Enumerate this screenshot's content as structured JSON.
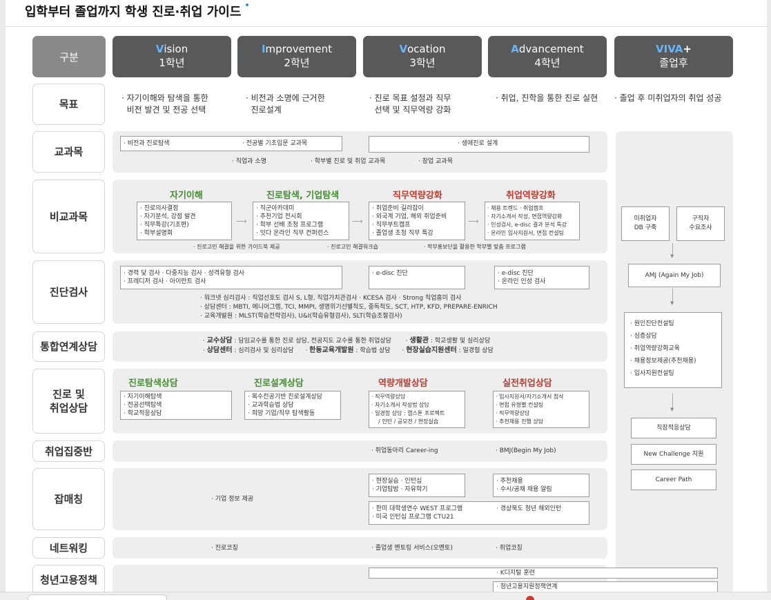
{
  "title": "입학부터 졸업까지 학생 진로·취업 가이드",
  "headers": [
    {
      "cap": "",
      "rest": "구분",
      "sub": ""
    },
    {
      "cap": "V",
      "rest": "ision",
      "sub": "1학년"
    },
    {
      "cap": "I",
      "rest": "mprovement",
      "sub": "2학년"
    },
    {
      "cap": "V",
      "rest": "ocation",
      "sub": "3학년"
    },
    {
      "cap": "A",
      "rest": "dvancement",
      "sub": "4학년"
    },
    {
      "cap": "VIVA",
      "rest": "+",
      "sub": "졸업후"
    }
  ],
  "rows": [
    "목표",
    "교과목",
    "비교과목",
    "진단검사",
    "통합연계상담",
    "진로 및\n취업상담",
    "취업집중반",
    "잡매칭",
    "네트워킹",
    "청년고용정책"
  ],
  "goals": [
    "· 자기이해와 탐색을 통한\n  비전 발견 및 전공 선택",
    "· 비전과 소명에 근거한\n  진로설계",
    "· 진로 목표 설정과 직무\n  선택 및 직무역량 강화",
    "· 취업, 진학을 통한 진로 실현",
    "· 졸업 후 미취업자의 취업 성공"
  ],
  "curriculum": {
    "box1a": "· 비전과 진로탐색",
    "box1b": "· 전공별 기초입문 교과목",
    "box2": "· 생애진로 설계",
    "line1": "· 직업과 소명",
    "line2": "· 학부별 진로 및 취업 교과목",
    "line3": "· 창업 교과목"
  },
  "extracurricular": {
    "cats": [
      "자기이해",
      "진로탐색, 기업탐색",
      "직무역량강화",
      "취업역량강화"
    ],
    "b1": [
      "· 진로의사결정",
      "· 자기분석, 강점 발견",
      "· 직무특강(기초편)",
      "· 학부설명회"
    ],
    "b2": [
      "· 직군아카데미",
      "· 추천기업 전시회",
      "· 학부 선배 초청 프로그램",
      "· 잇다 온라인 직무 컨퍼런스"
    ],
    "b3": [
      "· 취업준비 길라잡이",
      "· 외국계 기업, 해외 취업준비",
      "· 직무부트캠프",
      "· 졸업생 초청 직무 특강"
    ],
    "b4": [
      "· 채용 트렌드   · 취업캠프",
      "· 자기소개서 작성, 면접역량강화",
      "· 인성검사, e-disc 결과 분석 특강",
      "· 온라인 입사지원서, 면접 컨설팅"
    ],
    "notes": [
      "· 진로고민 해결을 위한 가이드북 제공",
      "· 진로고민 해결워크숍",
      "· 학부홍보단을 활용한 학부별 맞춤 프로그램"
    ]
  },
  "diagnostic": {
    "b1": [
      "· 경력 닻 검사      · 다중지능 검사  · 성격유형 검사",
      "· 프레디저 검사      · 아이란트 검사"
    ],
    "b2": "· e-disc 진단",
    "b3": [
      "· e-disc 진단",
      "· 온라인 인성 검사"
    ],
    "lines": [
      "· 워크넷 심리검사 : 직업선호도 검사 S, L형, 직업가치관검사     · KCESA 검사     · Strong 직업흥미 검사",
      "· 상담센터 : MBTI, 에니어그램, TCI, MMPI, 생명위기선별척도, 중독척도, SCT, HTP, KFD, PREPARE-ENRICH",
      "· 교육개발원 : MLST(학습전략검사), U&I(학습유형검사), SLT(학습조절검사)"
    ]
  },
  "integrated": {
    "l1a": "교수상담",
    "l1b": " : 담임교수를 통한 진로 상담, 전공지도 교수를 통한 취업상담",
    "l1c": "생활관",
    "l1d": " : 학교생활 및 심리상담",
    "l2a": "상담센터",
    "l2b": " : 심리검사 및 심리상담",
    "l2c": "한동교육개발원",
    "l2d": " : 학습법 상담",
    "l2e": "현장실습지원센터",
    "l2f": " : 일경험 상담"
  },
  "counseling": {
    "cats": [
      "진로탐색상담",
      "진로설계상담",
      "역량개발상담",
      "실전취업상담"
    ],
    "b1": [
      "· 자기이해탐색",
      "· 전공선택탐색",
      "· 학교적응상담"
    ],
    "b2": [
      "· 복수전공기반 진로설계상담",
      "· 교과학습법 상담",
      "· 희망 기업/직무 탐색활동"
    ],
    "b3": [
      "· 직무역량상담",
      "· 자기소개서 작성법 상담",
      "· 일경험 상담 : 캡스톤 프로젝트",
      "    / 인턴 / 공모전 / 현장실습"
    ],
    "b4": [
      "· 입사지원서/자기소개서 첨삭",
      "· 면접 유형별 컨설팅",
      "· 직무역량상담",
      "· 추천채용 진행 상담"
    ]
  },
  "intensive": {
    "a": "· 취업동아리 Career-ing",
    "b": "· BMJ(Begin My Job)"
  },
  "jobmatch": {
    "left": "· 기업 정보 제공",
    "b1": [
      "· 현장실습      · 인턴십",
      "· 기업탐방      · 자유학기"
    ],
    "b2": [
      "· 추천채용",
      "· 수시/공채 채용 알림"
    ],
    "b3": [
      "· 한미 대학생연수 WEST 프로그램",
      "· 미국 인턴십 프로그램 CTU21"
    ],
    "b4": "· 경상북도 청년 해외인턴"
  },
  "networking": {
    "a": "· 진로코칭",
    "b": "· 졸업생 멘토링 서비스(오멘토)",
    "c": "· 취업코칭"
  },
  "policy": {
    "a": "· K디지털 훈련",
    "b": "· 청년고용지원정책연계"
  },
  "right": {
    "top_left": "미취업자\nDB 구축",
    "top_right": "구직자\n수요조사",
    "amj": "AMJ (Again My Job)",
    "list": [
      "· 원인진단컨설팅",
      "· 심층상담",
      "· 취업역량강화교육",
      "· 채용정보제공(추천채용)",
      "· 입사지원컨설팅"
    ],
    "b1": "직장적응상담",
    "b2": "New Challenge 지원",
    "b3": "Career Path"
  },
  "colors": {
    "header_dark": "#58595b",
    "header_label": "#8a8a8a",
    "accent_blue": "#63b6ff",
    "category_green": "#3f8f2c",
    "category_red": "#c0392b",
    "panel_gray": "#eeeeee"
  }
}
